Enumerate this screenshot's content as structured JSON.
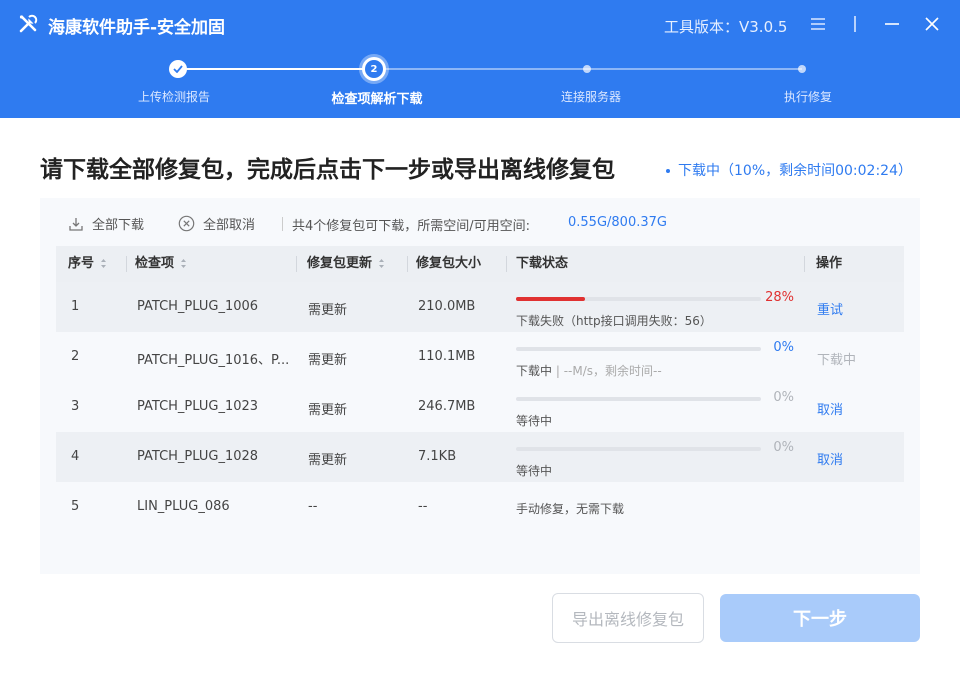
{
  "window": {
    "title": "海康软件助手-安全加固",
    "version_label": "工具版本：V3.0.5"
  },
  "stepper": {
    "current_index_label": "2",
    "steps": [
      {
        "label": "上传检测报告",
        "state": "done"
      },
      {
        "label": "检查项解析下载",
        "state": "current"
      },
      {
        "label": "连接服务器",
        "state": "todo"
      },
      {
        "label": "执行修复",
        "state": "todo"
      }
    ]
  },
  "main": {
    "headline": "请下载全部修复包，完成后点击下一步或导出离线修复包",
    "download_status": "下载中（10%，剩余时间00:02:24）"
  },
  "toolbar": {
    "download_all": "全部下载",
    "cancel_all": "全部取消",
    "info": "共4个修复包可下载，所需空间/可用空间:",
    "space": "0.55G/800.37G"
  },
  "table": {
    "headers": [
      "序号",
      "检查项",
      "修复包更新",
      "修复包大小",
      "下载状态",
      "操作"
    ],
    "rows": [
      {
        "no": "1",
        "name": "PATCH_PLUG_1006",
        "update": "需更新",
        "size": "210.0MB",
        "progress": 0.28,
        "pct": "28%",
        "status": "下载失败（http接口调用失败：56）",
        "status_extra": "",
        "op": "重试",
        "op_state": "link",
        "pct_color": "#e03131",
        "bar_color": "#e03131"
      },
      {
        "no": "2",
        "name": "PATCH_PLUG_1016、P...",
        "update": "需更新",
        "size": "110.1MB",
        "progress": 0,
        "pct": "0%",
        "status": "下载中",
        "status_extra": "| --M/s，剩余时间--",
        "op": "下载中",
        "op_state": "disabled",
        "pct_color": "#2f7bf0",
        "bar_color": "#2f7bf0"
      },
      {
        "no": "3",
        "name": "PATCH_PLUG_1023",
        "update": "需更新",
        "size": "246.7MB",
        "progress": 0,
        "pct": "0%",
        "status": "等待中",
        "status_extra": "",
        "op": "取消",
        "op_state": "link",
        "pct_color": "#b0b4ba",
        "bar_color": "#b0b4ba"
      },
      {
        "no": "4",
        "name": "PATCH_PLUG_1028",
        "update": "需更新",
        "size": "7.1KB",
        "progress": 0,
        "pct": "0%",
        "status": "等待中",
        "status_extra": "",
        "op": "取消",
        "op_state": "link",
        "pct_color": "#b0b4ba",
        "bar_color": "#b0b4ba"
      },
      {
        "no": "5",
        "name": "LIN_PLUG_086",
        "update": "--",
        "size": "--",
        "status": "手动修复，无需下载"
      }
    ]
  },
  "footer": {
    "export_label": "导出离线修复包",
    "next_label": "下一步"
  },
  "colors": {
    "primary": "#2f7bf0",
    "error": "#e03131",
    "next_disabled": "#a9cbfa"
  }
}
